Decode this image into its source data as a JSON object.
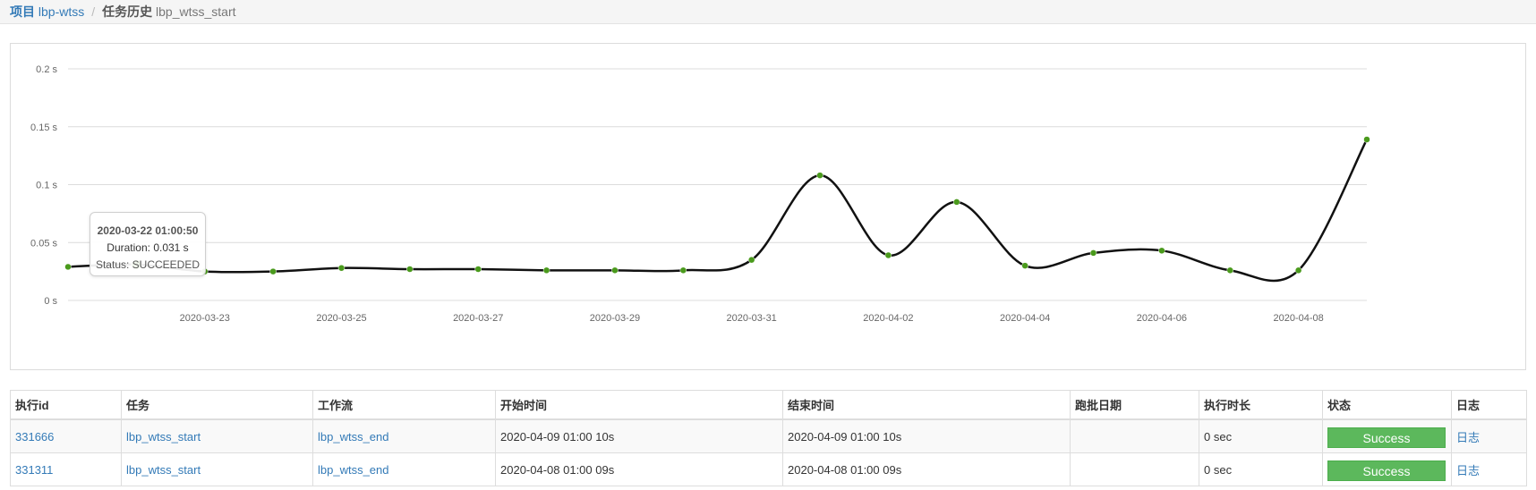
{
  "breadcrumb": {
    "project_label": "项目",
    "project_name": "lbp-wtss",
    "separator": "/",
    "history_label": "任务历史",
    "job_name": "lbp_wtss_start"
  },
  "tooltip": {
    "title": "2020-03-22 01:00:50",
    "duration": "Duration: 0.031 s",
    "status": "Status: SUCCEEDED"
  },
  "chart_data": {
    "type": "line",
    "xlabel": "",
    "ylabel": "",
    "ylim": [
      0,
      0.2
    ],
    "y_ticks": [
      "0 s",
      "0.05 s",
      "0.1 s",
      "0.15 s",
      "0.2 s"
    ],
    "x_ticks": [
      "2020-03-23",
      "2020-03-25",
      "2020-03-27",
      "2020-03-29",
      "2020-03-31",
      "2020-04-02",
      "2020-04-04",
      "2020-04-06",
      "2020-04-08"
    ],
    "grid": true,
    "x": [
      "2020-03-21",
      "2020-03-22",
      "2020-03-23",
      "2020-03-24",
      "2020-03-25",
      "2020-03-26",
      "2020-03-27",
      "2020-03-28",
      "2020-03-29",
      "2020-03-30",
      "2020-03-31",
      "2020-04-01",
      "2020-04-02",
      "2020-04-03",
      "2020-04-04",
      "2020-04-05",
      "2020-04-06",
      "2020-04-07",
      "2020-04-08",
      "2020-04-09"
    ],
    "values": [
      0.029,
      0.031,
      0.025,
      0.025,
      0.028,
      0.027,
      0.027,
      0.026,
      0.026,
      0.026,
      0.035,
      0.108,
      0.039,
      0.085,
      0.03,
      0.041,
      0.043,
      0.026,
      0.026,
      0.139
    ],
    "highlight_index": 1,
    "line_color": "#111111",
    "marker_color": "#4a9a1c"
  },
  "table": {
    "headers": [
      "执行id",
      "任务",
      "工作流",
      "开始时间",
      "结束时间",
      "跑批日期",
      "执行时长",
      "状态",
      "日志"
    ],
    "rows": [
      {
        "exec_id": "331666",
        "job": "lbp_wtss_start",
        "flow": "lbp_wtss_end",
        "start": "2020-04-09 01:00 10s",
        "end": "2020-04-09 01:00 10s",
        "batch_date": "",
        "duration": "0 sec",
        "status": "Success",
        "log": "日志"
      },
      {
        "exec_id": "331311",
        "job": "lbp_wtss_start",
        "flow": "lbp_wtss_end",
        "start": "2020-04-08 01:00 09s",
        "end": "2020-04-08 01:00 09s",
        "batch_date": "",
        "duration": "0 sec",
        "status": "Success",
        "log": "日志"
      }
    ]
  },
  "colors": {
    "link": "#337ab7",
    "success": "#5cb85c"
  }
}
